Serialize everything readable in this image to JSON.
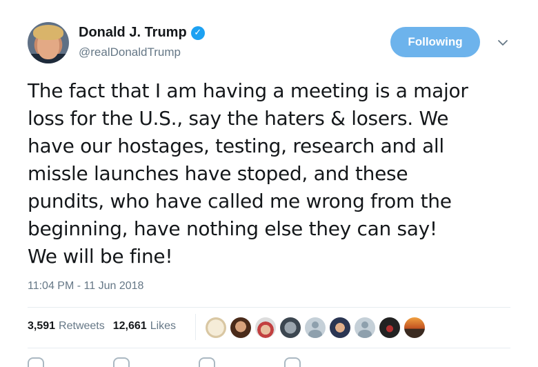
{
  "user": {
    "display_name": "Donald J. Trump",
    "handle": "@realDonaldTrump",
    "verified_icon": "verified-badge-icon",
    "avatar_icon": "profile-photo"
  },
  "follow_button": {
    "label": "Following",
    "color": "#6db3ec"
  },
  "tweet": {
    "text": "The fact that I am having a meeting is a major\nloss for the U.S., say the haters & losers. We\nhave our hostages, testing, research and all\nmissle launches have stoped, and these\npundits, who have called me wrong from the\nbeginning, have nothing else they can say!\nWe will be fine!",
    "timestamp": "11:04 PM - 11 Jun 2018"
  },
  "stats": {
    "retweets_count": "3,591",
    "retweets_label": "Retweets",
    "likes_count": "12,661",
    "likes_label": "Likes"
  },
  "colors": {
    "accent": "#1da1f2",
    "muted": "#657786",
    "text": "#14171a",
    "divider": "#e6ecf0"
  }
}
